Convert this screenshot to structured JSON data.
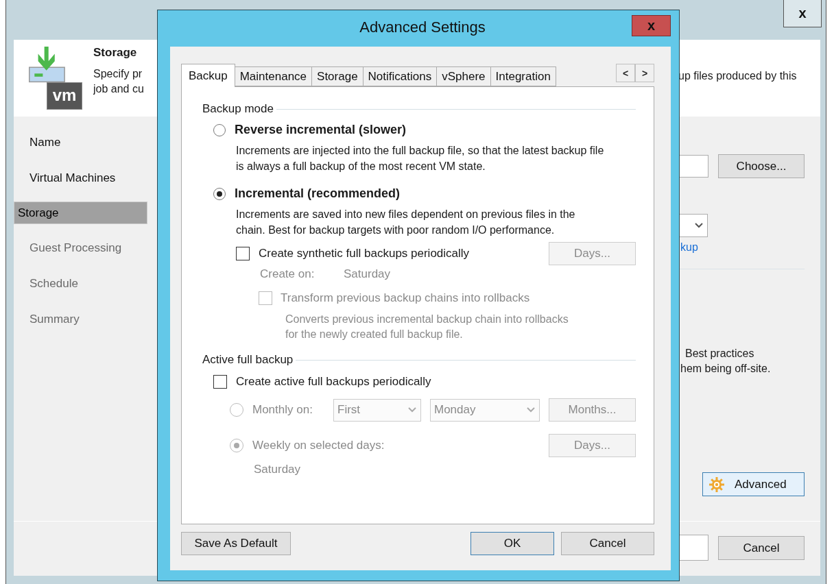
{
  "background_window": {
    "close": "x",
    "header": {
      "logo_text": "vm",
      "title": "Storage",
      "description_lines": [
        "Specify pr",
        "job and cu"
      ],
      "description_right": "up files produced by this"
    },
    "steps": [
      {
        "label": "Name",
        "selected": false,
        "disabled": false
      },
      {
        "label": "Virtual Machines",
        "selected": false,
        "disabled": false
      },
      {
        "label": "Storage",
        "selected": true,
        "disabled": false
      },
      {
        "label": "Guest Processing",
        "selected": false,
        "disabled": true
      },
      {
        "label": "Schedule",
        "selected": false,
        "disabled": true
      },
      {
        "label": "Summary",
        "selected": false,
        "disabled": true
      }
    ],
    "content": {
      "choose_button": "Choose...",
      "link_fragment": "kup",
      "note_lines": [
        "Best practices",
        "hem being off-site."
      ],
      "advanced_button": "Advanced"
    },
    "footer": {
      "cancel_button": "Cancel"
    }
  },
  "dialog": {
    "title": "Advanced Settings",
    "close": "x",
    "tabs": [
      {
        "label": "Backup",
        "selected": true
      },
      {
        "label": "Maintenance",
        "selected": false
      },
      {
        "label": "Storage",
        "selected": false
      },
      {
        "label": "Notifications",
        "selected": false
      },
      {
        "label": "vSphere",
        "selected": false
      },
      {
        "label": "Integration",
        "selected": false
      }
    ],
    "tab_scroll": [
      "<",
      ">"
    ],
    "backup_mode": {
      "label": "Backup mode",
      "options": [
        {
          "label": "Reverse incremental (slower)",
          "selected": false,
          "description": "Increments are injected into the full backup file, so that the latest backup file is always a full backup of the most recent VM state."
        },
        {
          "label": "Incremental (recommended)",
          "selected": true,
          "description": "Increments are saved into new files dependent on previous files in the chain. Best for backup targets with poor random I/O performance."
        }
      ]
    },
    "synthetic_full": {
      "label": "Create synthetic full backups periodically",
      "checked": false,
      "days_button": {
        "label": "Days...",
        "disabled": true
      },
      "create_on": {
        "label": "Create on:",
        "value": "Saturday",
        "disabled": true
      },
      "transform": {
        "label": "Transform previous backup chains into rollbacks",
        "checked": false,
        "disabled": true,
        "description": "Converts previous incremental backup chain into rollbacks for the newly created full backup file."
      }
    },
    "active_full": {
      "label": "Active full backup",
      "checkbox": {
        "label": "Create active full backups periodically",
        "checked": false
      },
      "schedule": [
        {
          "kind": "monthly",
          "label": "Monthly on:",
          "selected": false,
          "disabled": true,
          "selects": [
            "First",
            "Monday"
          ],
          "button": "Months..."
        },
        {
          "kind": "weekly",
          "label": "Weekly on selected days:",
          "selected": true,
          "disabled": true,
          "button": "Days...",
          "value": "Saturday"
        }
      ]
    },
    "buttons": {
      "save_default": "Save As Default",
      "ok": "OK",
      "cancel": "Cancel"
    }
  }
}
